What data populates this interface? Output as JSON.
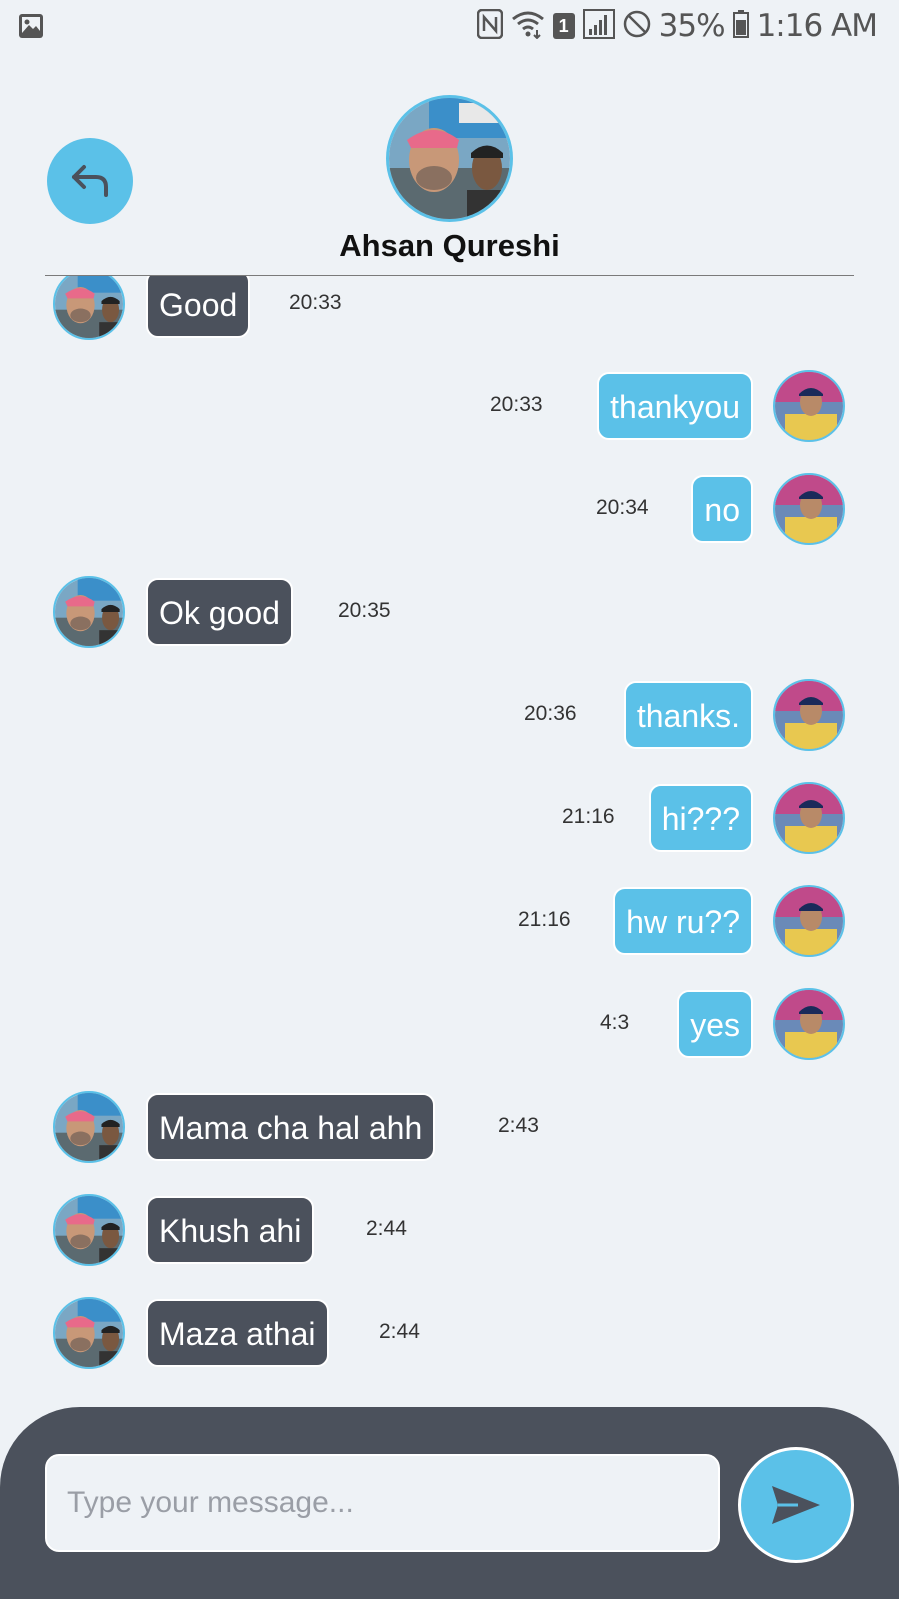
{
  "status_bar": {
    "battery_percent": "35%",
    "time": "1:16 AM",
    "sim_badge": "1"
  },
  "header": {
    "contact_name": "Ahsan Qureshi"
  },
  "messages": [
    {
      "text": "Good",
      "time": "20:33",
      "direction": "incoming"
    },
    {
      "text": "thankyou",
      "time": "20:33",
      "direction": "outgoing"
    },
    {
      "text": "no",
      "time": "20:34",
      "direction": "outgoing"
    },
    {
      "text": "Ok good",
      "time": "20:35",
      "direction": "incoming"
    },
    {
      "text": "thanks.",
      "time": "20:36",
      "direction": "outgoing"
    },
    {
      "text": "hi???",
      "time": "21:16",
      "direction": "outgoing"
    },
    {
      "text": "hw ru??",
      "time": "21:16",
      "direction": "outgoing"
    },
    {
      "text": "yes",
      "time": "4:3",
      "direction": "outgoing"
    },
    {
      "text": "Mama cha hal ahh",
      "time": "2:43",
      "direction": "incoming"
    },
    {
      "text": "Khush ahi",
      "time": "2:44",
      "direction": "incoming"
    },
    {
      "text": "Maza athai",
      "time": "2:44",
      "direction": "incoming"
    }
  ],
  "composer": {
    "placeholder": "Type your message..."
  },
  "colors": {
    "accent": "#5bc1e8",
    "incoming_bubble": "#4b515c",
    "background": "#eef2f6"
  }
}
